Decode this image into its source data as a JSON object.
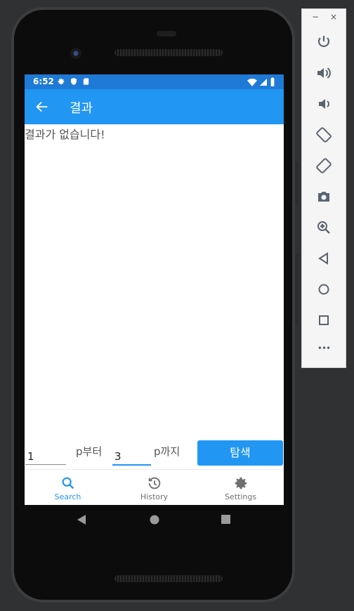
{
  "status_bar": {
    "time": "6:52",
    "color": "#1e7ad6"
  },
  "app_bar": {
    "title": "결과",
    "color": "#2196f3"
  },
  "results": {
    "empty_message": "결과가 없습니다!"
  },
  "pager": {
    "from_value": "1",
    "from_label": "p부터",
    "to_value": "3",
    "to_label": "p까지",
    "search_button": "탐색"
  },
  "bottom_nav": {
    "items": [
      {
        "label": "Search",
        "icon": "search-icon",
        "active": true
      },
      {
        "label": "History",
        "icon": "history-icon",
        "active": false
      },
      {
        "label": "Settings",
        "icon": "gear-icon",
        "active": false
      }
    ],
    "accent": "#2196f3"
  },
  "emulator_toolbar": {
    "minimize": "−",
    "close": "×",
    "tools": [
      "power-icon",
      "volume-up-icon",
      "volume-down-icon",
      "rotate-left-icon",
      "rotate-right-icon",
      "camera-icon",
      "zoom-icon",
      "back-icon",
      "home-icon",
      "overview-icon",
      "more-icon"
    ],
    "more": "•••"
  }
}
